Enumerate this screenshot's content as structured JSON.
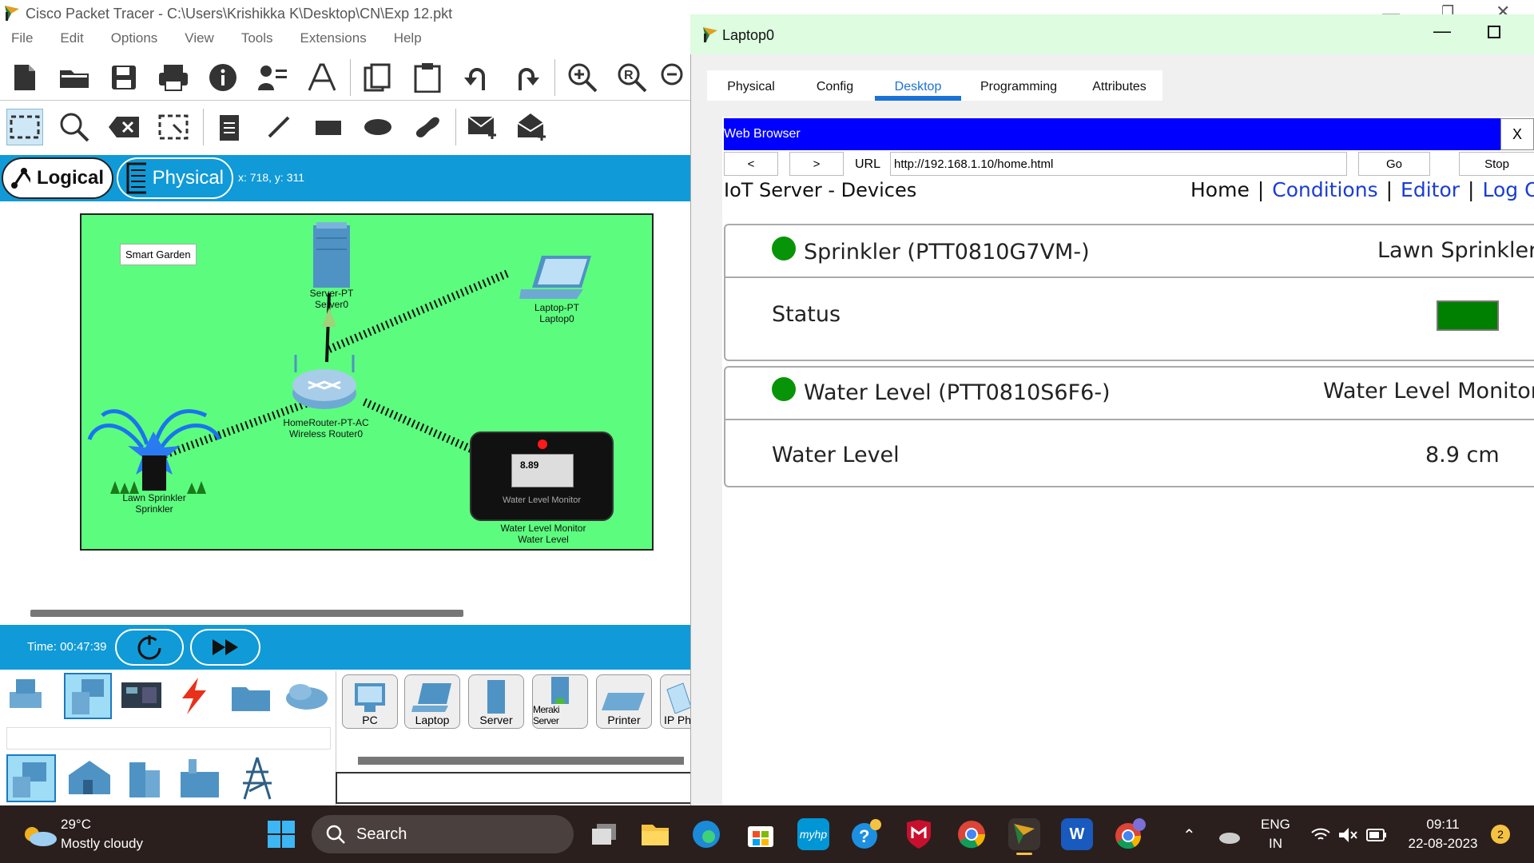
{
  "app": {
    "title": "Cisco Packet Tracer - C:\\Users\\Krishikka K\\Desktop\\CN\\Exp 12.pkt"
  },
  "menu": [
    "File",
    "Edit",
    "Options",
    "View",
    "Tools",
    "Extensions",
    "Help"
  ],
  "modes": {
    "logical": "Logical",
    "physical": "Physical",
    "coords": "x: 718, y: 311"
  },
  "workspace": {
    "cluster_label": "Smart Garden",
    "devices": {
      "server": "Server-PT\nServer0",
      "laptop": "Laptop-PT\nLaptop0",
      "router": "HomeRouter-PT-AC\nWireless Router0",
      "sprinkler": "Lawn Sprinkler\nSprinkler",
      "monitor": "Water Level Monitor\nWater Level",
      "monitor_display": "8.89",
      "monitor_caption": "Water Level Monitor"
    }
  },
  "sim": {
    "time": "Time: 00:47:39"
  },
  "device_types": [
    "PC",
    "Laptop",
    "Server",
    "Meraki Server",
    "Printer",
    "IP Ph"
  ],
  "laptop_window": {
    "title": "Laptop0",
    "tabs": [
      "Physical",
      "Config",
      "Desktop",
      "Programming",
      "Attributes"
    ],
    "active_tab": "Desktop"
  },
  "browser": {
    "title": "Web Browser",
    "close": "X",
    "back": "<",
    "forward": ">",
    "url_label": "URL",
    "url": "http://192.168.1.10/home.html",
    "go": "Go",
    "stop": "Stop",
    "heading": "IoT Server - Devices",
    "nav": {
      "home": "Home",
      "sep": "|",
      "conditions": "Conditions",
      "editor": "Editor",
      "logout": "Log Ou"
    },
    "devices": [
      {
        "name": "Sprinkler (PTT0810G7VM-)",
        "type": "Lawn Sprinkler",
        "field": "Status",
        "status_color": "#008000"
      },
      {
        "name": "Water Level (PTT0810S6F6-)",
        "type": "Water Level Monitor",
        "field": "Water Level",
        "value": "8.9 cm"
      }
    ]
  },
  "taskbar": {
    "weather_temp": "29°C",
    "weather_desc": "Mostly cloudy",
    "search": "Search",
    "lang1": "ENG",
    "lang2": "IN",
    "time": "09:11",
    "date": "22-08-2023",
    "notif": "2"
  }
}
